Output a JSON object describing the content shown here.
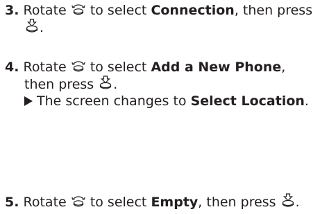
{
  "steps": [
    {
      "number": "3.",
      "pre": "Rotate",
      "mid": "to select",
      "target": "Connection",
      "post": ", then press"
    },
    {
      "number": "4.",
      "pre": "Rotate",
      "mid": "to select",
      "target": "Add a New Phone",
      "post": ",",
      "line2": "then press",
      "result_pre": "The screen changes to",
      "result_target": "Select Location",
      "result_post": "."
    },
    {
      "number": "5.",
      "pre": "Rotate",
      "mid": "to select",
      "target": "Empty",
      "post": ", then press"
    }
  ],
  "icons": {
    "rotate": "interface-dial-rotate-icon",
    "press": "interface-dial-press-icon",
    "result": "result-arrow-icon"
  }
}
